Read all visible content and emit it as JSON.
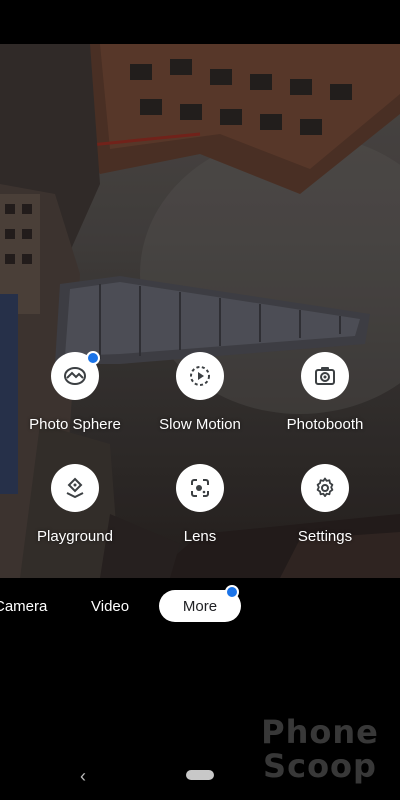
{
  "modes": [
    {
      "label": "Photo Sphere",
      "icon": "photo-sphere-icon",
      "has_new_badge": true
    },
    {
      "label": "Slow Motion",
      "icon": "slow-motion-icon",
      "has_new_badge": false
    },
    {
      "label": "Photobooth",
      "icon": "photobooth-icon",
      "has_new_badge": false
    },
    {
      "label": "Playground",
      "icon": "playground-icon",
      "has_new_badge": false
    },
    {
      "label": "Lens",
      "icon": "lens-icon",
      "has_new_badge": false
    },
    {
      "label": "Settings",
      "icon": "settings-gear-icon",
      "has_new_badge": false
    }
  ],
  "mode_bar": {
    "camera_label": "Camera",
    "video_label": "Video",
    "more_label": "More",
    "selected": "More"
  },
  "navigation": {
    "back_icon": "back-chevron-icon",
    "home_icon": "home-pill-icon"
  },
  "watermark": {
    "line1": "Phone",
    "line2": "Scoop"
  },
  "colors": {
    "accent": "#1a73e8",
    "chip_bg": "#ffffff",
    "bar_bg": "#000000"
  }
}
